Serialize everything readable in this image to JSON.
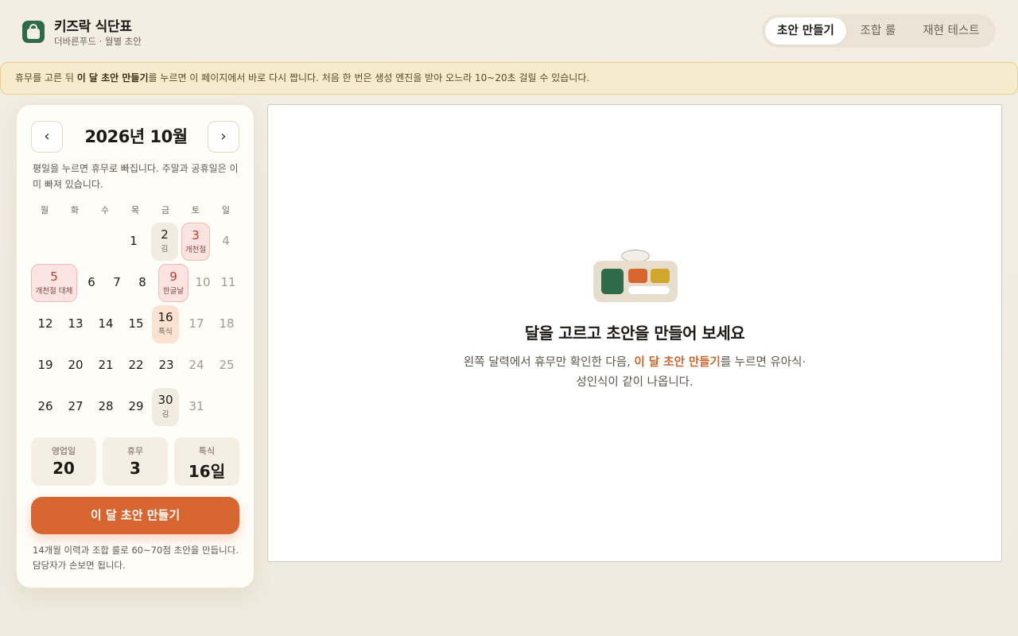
{
  "app": {
    "title": "키즈락 식단표",
    "subtitle": "더바른푸드 · 월별 초안"
  },
  "tabs": [
    {
      "label": "초안 만들기",
      "active": true
    },
    {
      "label": "조합 룰",
      "active": false
    },
    {
      "label": "재현 테스트",
      "active": false
    }
  ],
  "notice": {
    "pre": "휴무를 고른 뒤 ",
    "emphasis": "이 달 초안 만들기",
    "post": "를 누르면 이 페이지에서 바로 다시 짭니다. 처음 한 번은 생성 엔진을 받아 오느라 10~20초 걸릴 수 있습니다."
  },
  "calendar": {
    "prev_label": "‹",
    "next_label": "›",
    "month_title": "2026년 10월",
    "help": "평일을 누르면 휴무로 빠집니다. 주말과 공휴일은 이미 빠져 있습니다.",
    "weekdays": [
      "월",
      "화",
      "수",
      "목",
      "금",
      "토",
      "일"
    ],
    "days": [
      {
        "d": "1",
        "sub": "",
        "type": "normal"
      },
      {
        "d": "2",
        "sub": "김",
        "type": "kim"
      },
      {
        "d": "3",
        "sub": "개천절",
        "type": "holiday"
      },
      {
        "d": "4",
        "sub": "",
        "type": "weekend"
      },
      {
        "d": "5",
        "sub": "개천절 대체",
        "type": "holiday"
      },
      {
        "d": "6",
        "sub": "",
        "type": "normal"
      },
      {
        "d": "7",
        "sub": "",
        "type": "normal"
      },
      {
        "d": "8",
        "sub": "",
        "type": "normal"
      },
      {
        "d": "9",
        "sub": "한글날",
        "type": "holiday"
      },
      {
        "d": "10",
        "sub": "",
        "type": "weekend"
      },
      {
        "d": "11",
        "sub": "",
        "type": "weekend"
      },
      {
        "d": "12",
        "sub": "",
        "type": "normal"
      },
      {
        "d": "13",
        "sub": "",
        "type": "normal"
      },
      {
        "d": "14",
        "sub": "",
        "type": "normal"
      },
      {
        "d": "15",
        "sub": "",
        "type": "normal"
      },
      {
        "d": "16",
        "sub": "특식",
        "type": "special"
      },
      {
        "d": "17",
        "sub": "",
        "type": "weekend"
      },
      {
        "d": "18",
        "sub": "",
        "type": "weekend"
      },
      {
        "d": "19",
        "sub": "",
        "type": "normal"
      },
      {
        "d": "20",
        "sub": "",
        "type": "normal"
      },
      {
        "d": "21",
        "sub": "",
        "type": "normal"
      },
      {
        "d": "22",
        "sub": "",
        "type": "normal"
      },
      {
        "d": "23",
        "sub": "",
        "type": "normal"
      },
      {
        "d": "24",
        "sub": "",
        "type": "weekend"
      },
      {
        "d": "25",
        "sub": "",
        "type": "weekend"
      },
      {
        "d": "26",
        "sub": "",
        "type": "normal"
      },
      {
        "d": "27",
        "sub": "",
        "type": "normal"
      },
      {
        "d": "28",
        "sub": "",
        "type": "normal"
      },
      {
        "d": "29",
        "sub": "",
        "type": "normal"
      },
      {
        "d": "30",
        "sub": "김",
        "type": "kim"
      },
      {
        "d": "31",
        "sub": "",
        "type": "weekend"
      }
    ]
  },
  "stats": [
    {
      "label": "영업일",
      "value": "20"
    },
    {
      "label": "휴무",
      "value": "3"
    },
    {
      "label": "특식",
      "value": "16일"
    }
  ],
  "cta": {
    "label": "이 달 초안 만들기"
  },
  "footnote": "14개월 이력과 조합 룰로 60~70점 초안을 만듭니다. 담당자가 손보면 됩니다.",
  "empty": {
    "title": "달을 고르고 초안을 만들어 보세요",
    "desc_pre": "왼쪽 달력에서 휴무만 확인한 다음, ",
    "desc_emphasis": "이 달 초안 만들기",
    "desc_post": "를 누르면 유아식·성인식이 같이 나옵니다."
  },
  "colors": {
    "brand_green": "#2f6b48",
    "accent_orange": "#d7652f",
    "holiday_red": "#b73a32",
    "notice_bg": "#f6ebcd"
  },
  "icons": {
    "logo": "lunchbox-icon",
    "empty_state": "meal-tray-icon"
  }
}
